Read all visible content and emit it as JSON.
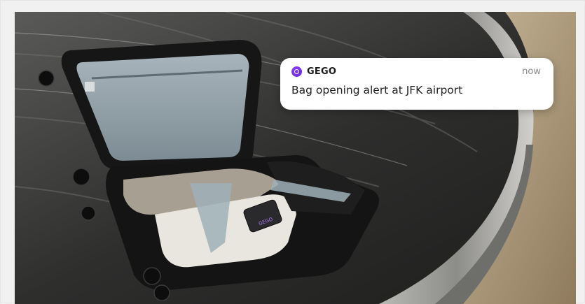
{
  "notification": {
    "app_icon": "gego-ring-icon",
    "app_name": "GEGO",
    "time": "now",
    "message": "Bag opening alert at JFK airport"
  },
  "photo": {
    "subject": "open-suitcase-on-baggage-carousel",
    "tracker_label": "GEGO"
  },
  "colors": {
    "accent": "#7b35f0",
    "card_background": "#ffffff",
    "page_background": "#f1f1f1"
  }
}
